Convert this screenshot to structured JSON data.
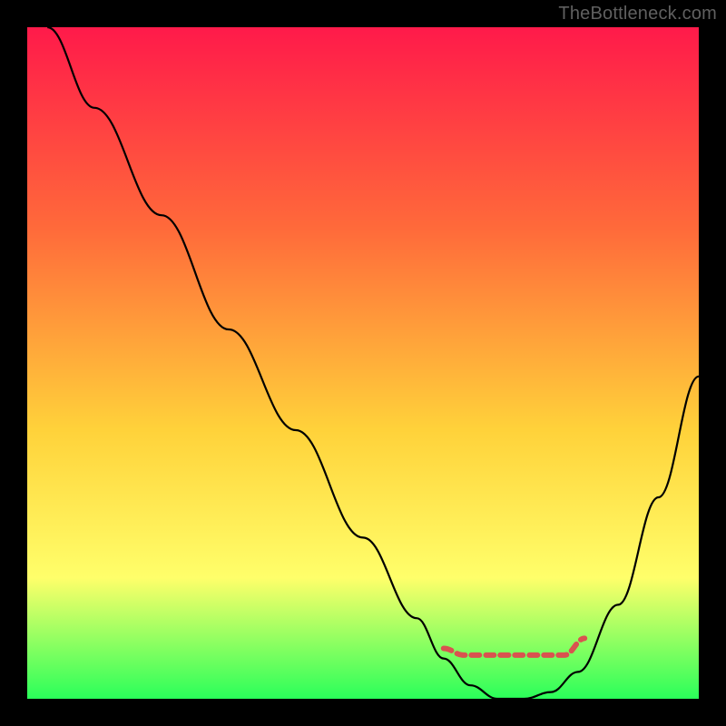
{
  "attribution": "TheBottleneck.com",
  "chart_data": {
    "type": "line",
    "title": "",
    "xlabel": "",
    "ylabel": "",
    "xlim": [
      0,
      100
    ],
    "ylim": [
      0,
      100
    ],
    "grid": false,
    "legend": false,
    "background_gradient": [
      "#ff1a4a",
      "#ff6a3a",
      "#ffd23a",
      "#ffff6a",
      "#2aff5a"
    ],
    "series": [
      {
        "name": "bottleneck-curve",
        "color": "#000000",
        "x": [
          3,
          10,
          20,
          30,
          40,
          50,
          58,
          62,
          66,
          70,
          74,
          78,
          82,
          88,
          94,
          100
        ],
        "y": [
          100,
          88,
          72,
          55,
          40,
          24,
          12,
          6,
          2,
          0,
          0,
          1,
          4,
          14,
          30,
          48
        ]
      },
      {
        "name": "optimal-zone-marker",
        "color": "#d9534f",
        "x": [
          62,
          65,
          68,
          71,
          74,
          77,
          80,
          83
        ],
        "y": [
          7.5,
          6.5,
          6.5,
          6.5,
          6.5,
          6.5,
          6.5,
          9
        ]
      }
    ],
    "annotations": []
  }
}
